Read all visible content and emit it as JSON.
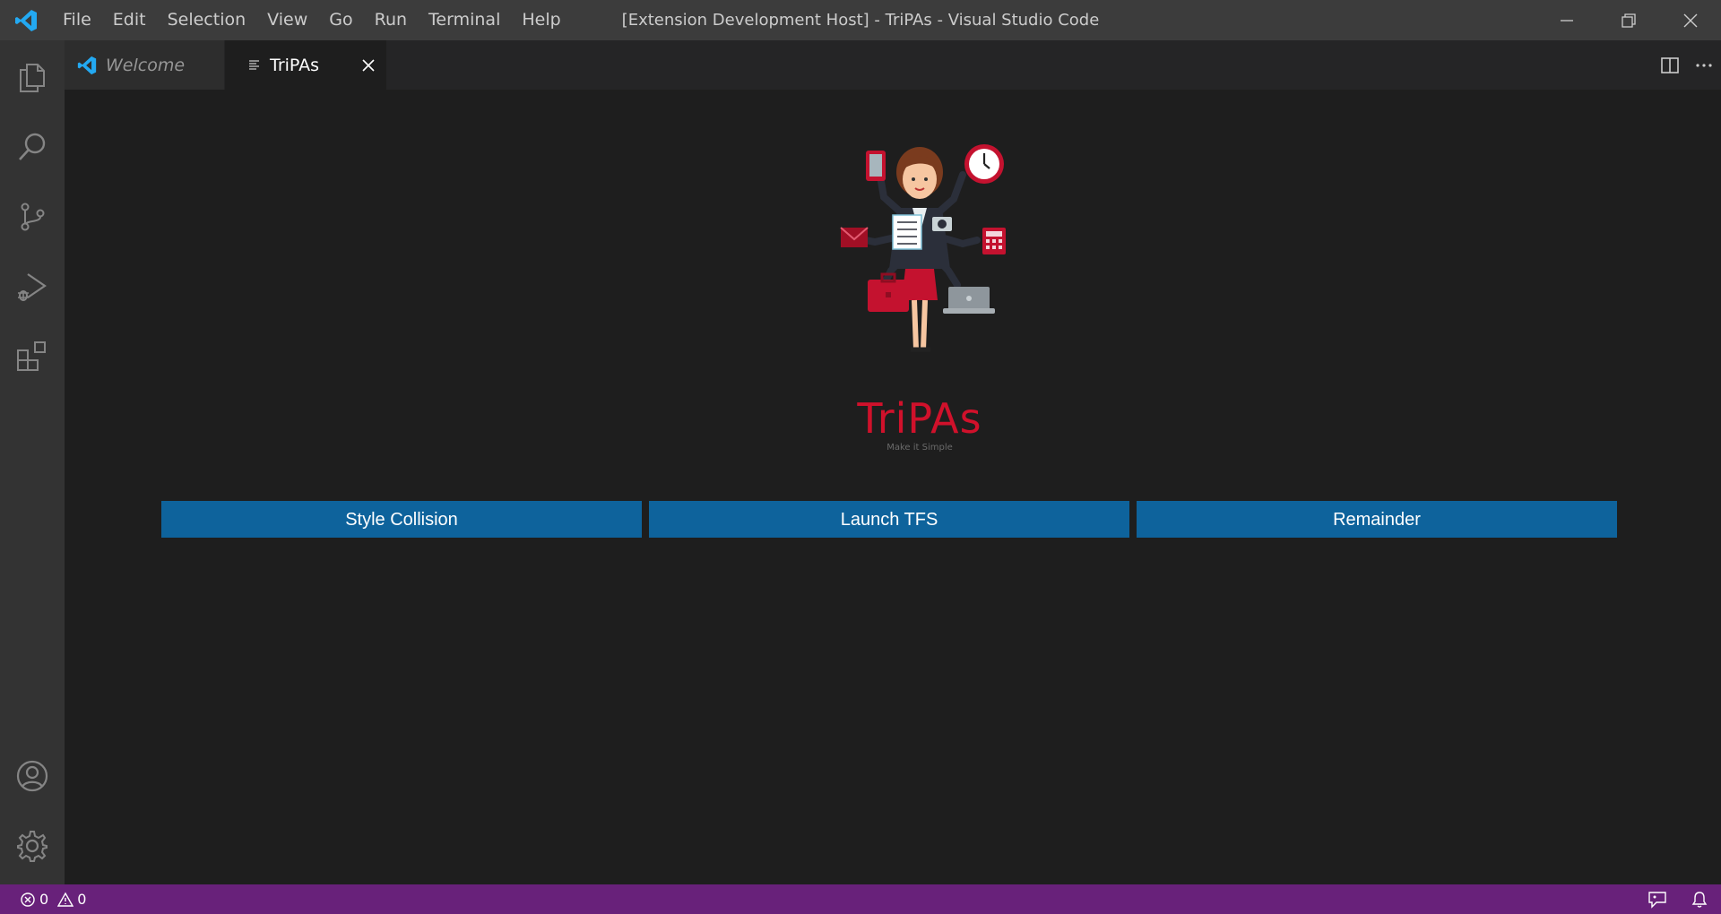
{
  "titlebar": {
    "menu": [
      "File",
      "Edit",
      "Selection",
      "View",
      "Go",
      "Run",
      "Terminal",
      "Help"
    ],
    "window_title": "[Extension Development Host] - TriPAs - Visual Studio Code"
  },
  "activity_bar": {
    "items": [
      "files-icon",
      "search-icon",
      "source-control-icon",
      "run-debug-icon",
      "extensions-icon"
    ],
    "bottom_items": [
      "account-icon",
      "settings-gear-icon"
    ]
  },
  "tabs": [
    {
      "label": "Welcome",
      "active": false,
      "preview": true
    },
    {
      "label": "TriPAs",
      "active": true,
      "preview": false
    }
  ],
  "hero": {
    "brand": "TriPAs",
    "tagline": "Make it Simple"
  },
  "buttons": [
    {
      "label": "Style Collision"
    },
    {
      "label": "Launch TFS"
    },
    {
      "label": "Remainder"
    }
  ],
  "status_bar": {
    "errors": "0",
    "warnings": "0"
  },
  "colors": {
    "accent_button": "#0e639c",
    "status_bar": "#68217a",
    "brand_red": "#d0112b",
    "vscode_blue": "#23a9f2"
  }
}
